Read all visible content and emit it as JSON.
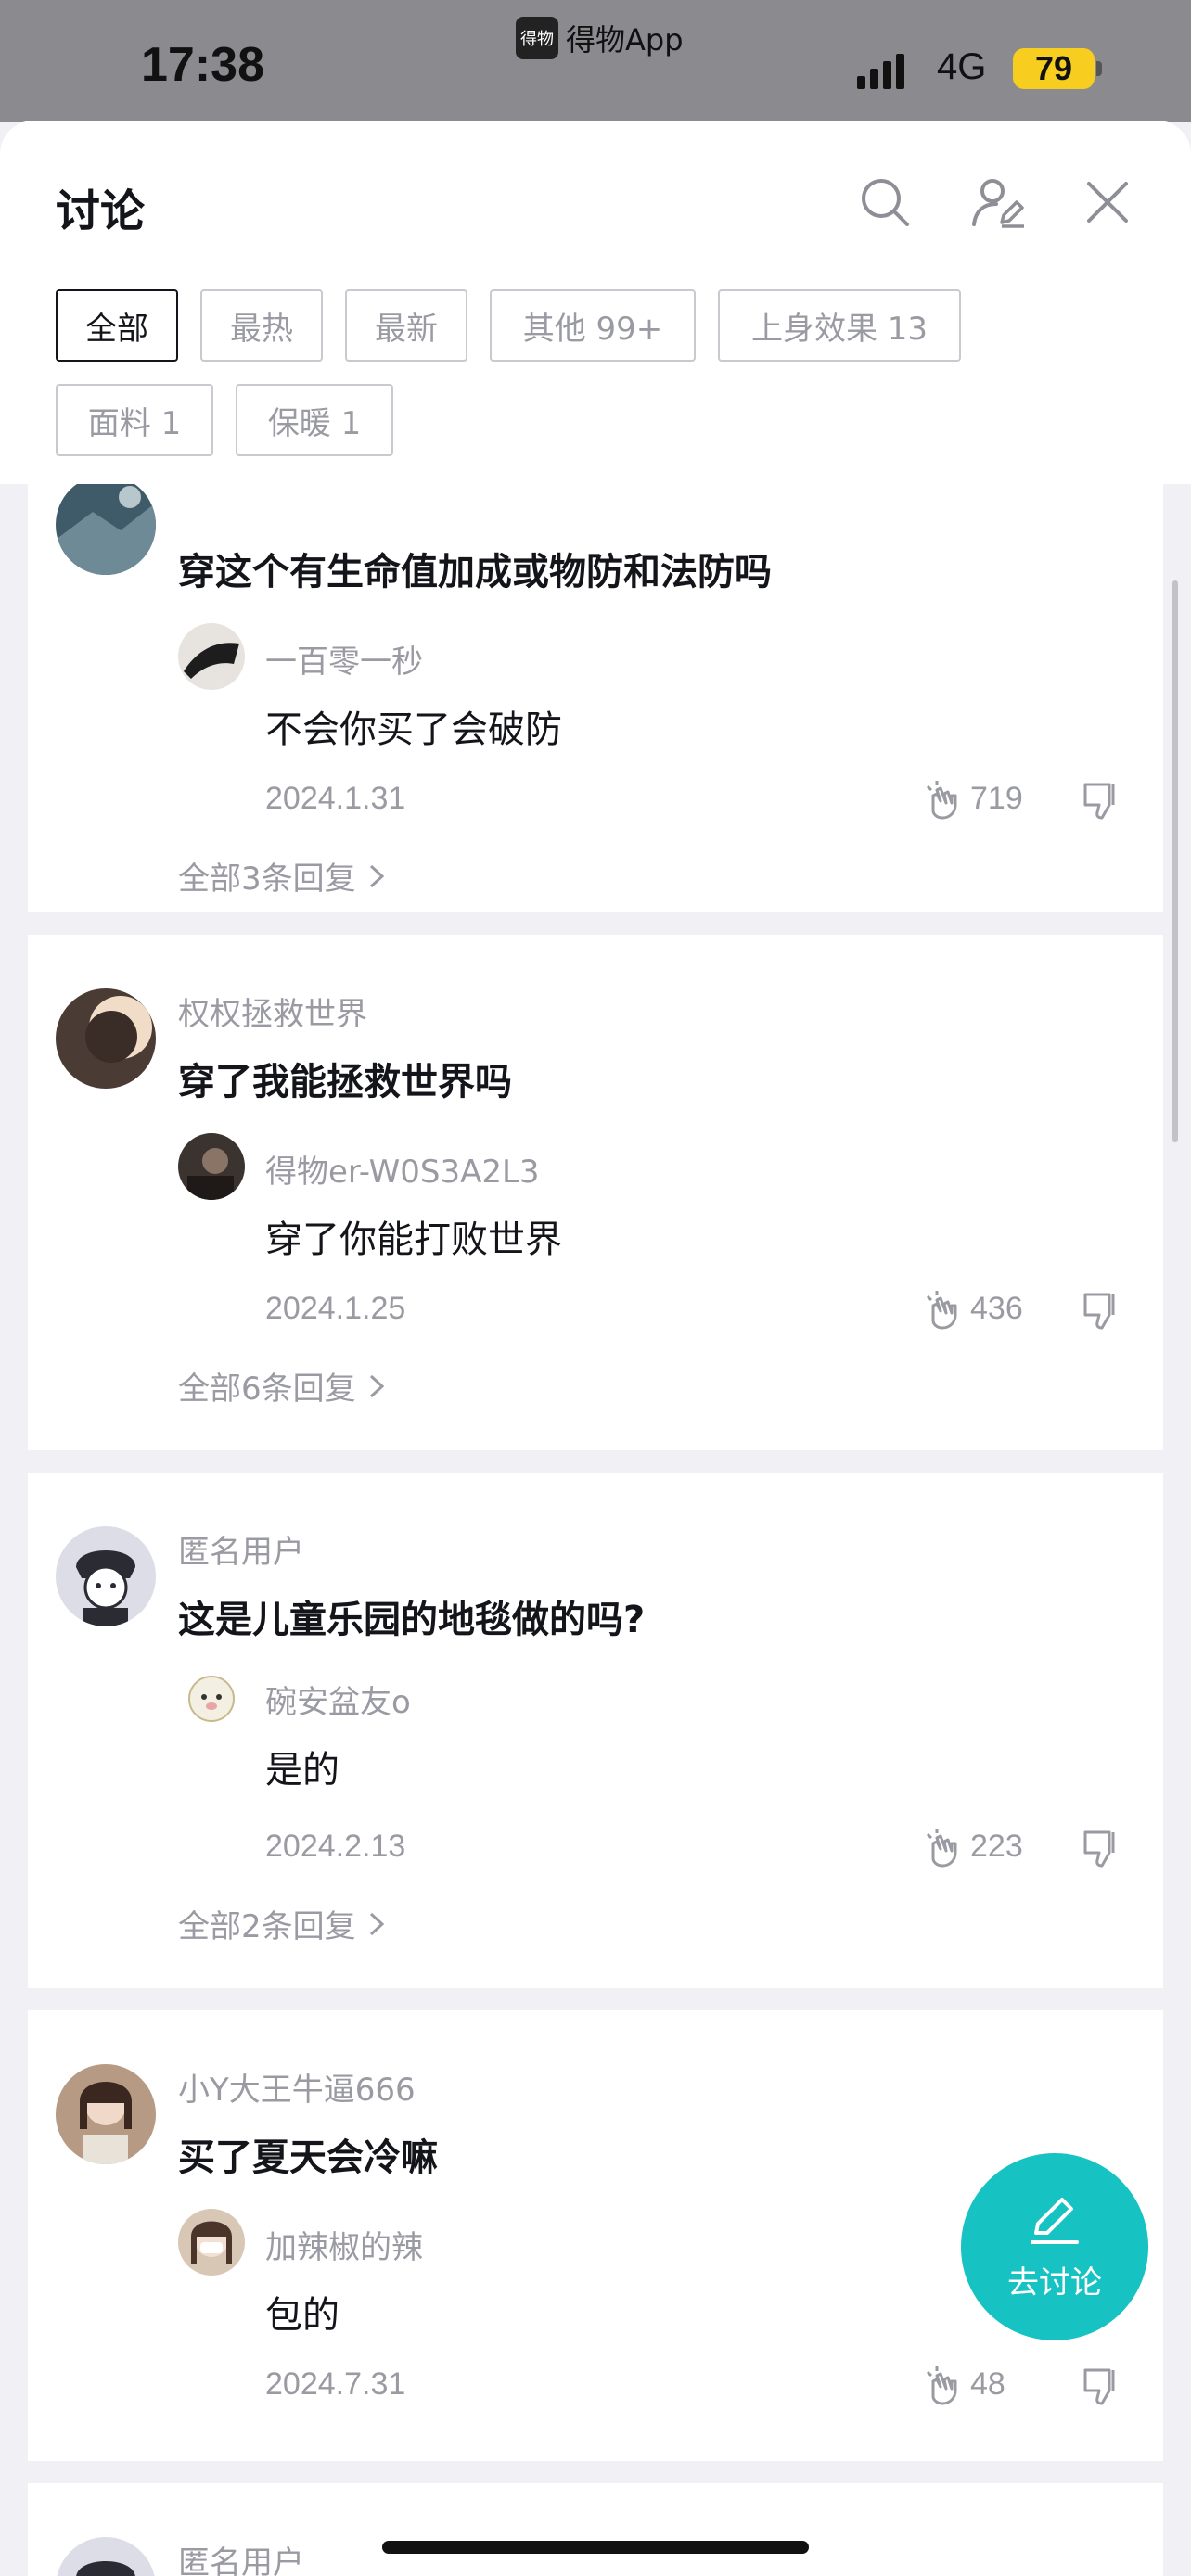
{
  "status_bar": {
    "time": "17:38",
    "app_name": "得物App",
    "app_logo_text": "得物",
    "network": "4G",
    "battery": "79"
  },
  "header": {
    "title": "讨论",
    "icons": [
      "search-icon",
      "user-edit-icon",
      "close-icon"
    ]
  },
  "filters": [
    {
      "label": "全部",
      "active": true
    },
    {
      "label": "最热",
      "active": false
    },
    {
      "label": "最新",
      "active": false
    },
    {
      "label": "其他 99+",
      "active": false
    },
    {
      "label": "上身效果 13",
      "active": false
    },
    {
      "label": "面料 1",
      "active": false
    },
    {
      "label": "保暖 1",
      "active": false
    }
  ],
  "posts": [
    {
      "user": "",
      "question": "穿这个有生命值加成或物防和法防吗",
      "reply": {
        "user": "一百零一秒",
        "text": "不会你买了会破防",
        "date": "2024.1.31",
        "likes": "719"
      },
      "all_replies": "全部3条回复"
    },
    {
      "user": "权权拯救世界",
      "question": "穿了我能拯救世界吗",
      "reply": {
        "user": "得物er-W0S3A2L3",
        "text": "穿了你能打败世界",
        "date": "2024.1.25",
        "likes": "436"
      },
      "all_replies": "全部6条回复"
    },
    {
      "user": "匿名用户",
      "question": "这是儿童乐园的地毯做的吗?",
      "reply": {
        "user": "碗安盆友o",
        "text": "是的",
        "date": "2024.2.13",
        "likes": "223"
      },
      "all_replies": "全部2条回复"
    },
    {
      "user": "小Y大王牛逼666",
      "question": "买了夏天会冷嘛",
      "reply": {
        "user": "加辣椒的辣",
        "text": "包的",
        "date": "2024.7.31",
        "likes": "48"
      },
      "all_replies": ""
    },
    {
      "user": "匿名用户",
      "question": "",
      "reply": null,
      "all_replies": ""
    }
  ],
  "fab": {
    "label": "去讨论",
    "icon": "pencil-icon"
  },
  "colors": {
    "accent": "#16c2c2",
    "text": "#14151a",
    "muted": "#9a9aa3",
    "background": "#f1f1f5"
  }
}
